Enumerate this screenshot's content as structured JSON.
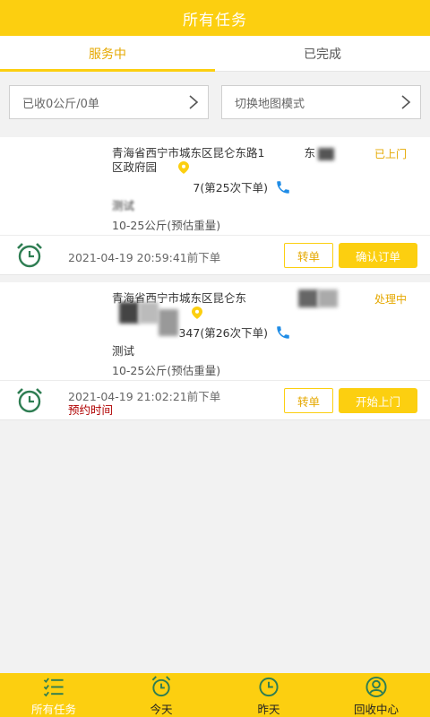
{
  "header": {
    "title": "所有任务"
  },
  "tabs": [
    {
      "label": "服务中",
      "active": true
    },
    {
      "label": "已完成",
      "active": false
    }
  ],
  "filters": {
    "collected": "已收0公斤/0单",
    "map_mode": "切换地图模式"
  },
  "orders": [
    {
      "address_line1": "青海省西宁市城东区昆仑东路1",
      "address_suffix": "东",
      "address_line2": "区政府园",
      "status": "已上门",
      "phone_tail": "7(第25次下单)",
      "name": "测试",
      "weight": "10-25公斤(预估重量)",
      "time": "2021-04-19 20:59:41前下单",
      "appointment": "",
      "transfer_label": "转单",
      "primary_label": "确认订单"
    },
    {
      "address_line1": "青海省西宁市城东区昆仑东",
      "address_suffix": "",
      "address_line2": "",
      "status": "处理中",
      "phone_tail": "347(第26次下单)",
      "name": "测试",
      "weight": "10-25公斤(预估重量)",
      "time": "2021-04-19 21:02:21前下单",
      "appointment": "预约时间",
      "transfer_label": "转单",
      "primary_label": "开始上门"
    }
  ],
  "bottom_nav": [
    {
      "label": "所有任务",
      "icon": "task-list-icon",
      "active": true
    },
    {
      "label": "今天",
      "icon": "alarm-clock-icon",
      "active": false
    },
    {
      "label": "昨天",
      "icon": "clock-icon",
      "active": false
    },
    {
      "label": "回收中心",
      "icon": "user-icon",
      "active": false
    }
  ],
  "colors": {
    "accent": "#fccf10",
    "accent_text": "#e5a800",
    "alarm_green": "#2e7d52",
    "phone_blue": "#1f8ce6",
    "appointment_red": "#b00000"
  }
}
